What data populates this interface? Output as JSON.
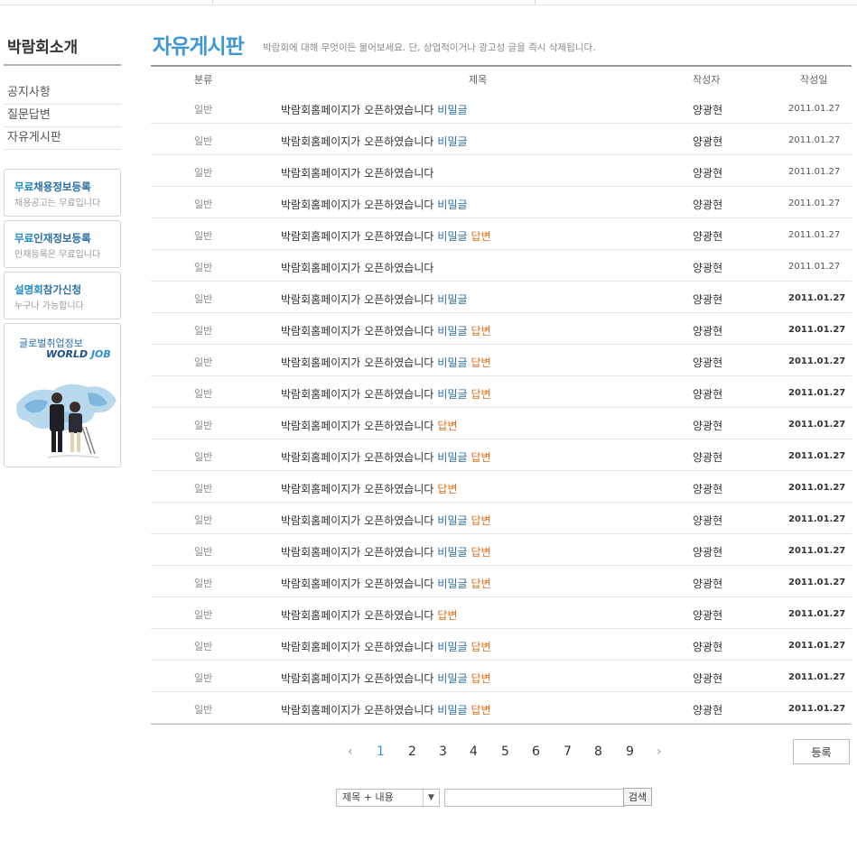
{
  "sidebar": {
    "title": "박람회소개",
    "menu": [
      "공지사항",
      "질문답변",
      "자유게시판"
    ],
    "banners": [
      {
        "title_prefix": "무료",
        "title_main": "채용정보등록",
        "sub": "채용공고는 무료입니다"
      },
      {
        "title_prefix": "무료",
        "title_main": "인재정보등록",
        "sub": "인재등록은 무료입니다"
      },
      {
        "title_prefix": "설명회",
        "title_main": "참가신청",
        "sub": "누구나 가능합니다"
      }
    ],
    "worldjob": {
      "korean": "글로벌취업정보",
      "logo_a": "WORLD ",
      "logo_b": "JOB"
    }
  },
  "board": {
    "title": "자유게시판",
    "description": "박람회에 대해 무엇이든 물어보세요. 단, 상업적이거나 광고성 글을 즉시 삭제됩니다.",
    "headers": {
      "category": "분류",
      "subject": "제목",
      "author": "작성자",
      "date": "작성일"
    },
    "secret_tag": "비밀글",
    "reply_tag": "답변",
    "rows": [
      {
        "category": "일반",
        "subject": "박람회홈페이지가 오픈하였습니다",
        "secret": true,
        "reply": false,
        "author": "양광현",
        "date": "2011.01.27",
        "bold": false
      },
      {
        "category": "일반",
        "subject": "박람회홈페이지가 오픈하였습니다",
        "secret": true,
        "reply": false,
        "author": "양광현",
        "date": "2011.01.27",
        "bold": false
      },
      {
        "category": "일반",
        "subject": "박람회홈페이지가 오픈하였습니다",
        "secret": false,
        "reply": false,
        "author": "양광현",
        "date": "2011.01.27",
        "bold": false
      },
      {
        "category": "일반",
        "subject": "박람회홈페이지가 오픈하였습니다",
        "secret": true,
        "reply": false,
        "author": "양광현",
        "date": "2011.01.27",
        "bold": false
      },
      {
        "category": "일반",
        "subject": "박람회홈페이지가 오픈하였습니다",
        "secret": true,
        "reply": true,
        "author": "양광현",
        "date": "2011.01.27",
        "bold": false
      },
      {
        "category": "일반",
        "subject": "박람회홈페이지가 오픈하였습니다",
        "secret": false,
        "reply": false,
        "author": "양광현",
        "date": "2011.01.27",
        "bold": false
      },
      {
        "category": "일반",
        "subject": "박람회홈페이지가 오픈하였습니다",
        "secret": true,
        "reply": false,
        "author": "양광현",
        "date": "2011.01.27",
        "bold": true
      },
      {
        "category": "일반",
        "subject": "박람회홈페이지가 오픈하였습니다",
        "secret": true,
        "reply": true,
        "author": "양광현",
        "date": "2011.01.27",
        "bold": true
      },
      {
        "category": "일반",
        "subject": "박람회홈페이지가 오픈하였습니다",
        "secret": true,
        "reply": true,
        "author": "양광현",
        "date": "2011.01.27",
        "bold": true
      },
      {
        "category": "일반",
        "subject": "박람회홈페이지가 오픈하였습니다",
        "secret": true,
        "reply": true,
        "author": "양광현",
        "date": "2011.01.27",
        "bold": true
      },
      {
        "category": "일반",
        "subject": "박람회홈페이지가 오픈하였습니다",
        "secret": false,
        "reply": true,
        "author": "양광현",
        "date": "2011.01.27",
        "bold": true
      },
      {
        "category": "일반",
        "subject": "박람회홈페이지가 오픈하였습니다",
        "secret": true,
        "reply": true,
        "author": "양광현",
        "date": "2011.01.27",
        "bold": true
      },
      {
        "category": "일반",
        "subject": "박람회홈페이지가 오픈하였습니다",
        "secret": false,
        "reply": true,
        "author": "양광현",
        "date": "2011.01.27",
        "bold": true
      },
      {
        "category": "일반",
        "subject": "박람회홈페이지가 오픈하였습니다",
        "secret": true,
        "reply": true,
        "author": "양광현",
        "date": "2011.01.27",
        "bold": true
      },
      {
        "category": "일반",
        "subject": "박람회홈페이지가 오픈하였습니다",
        "secret": true,
        "reply": true,
        "author": "양광현",
        "date": "2011.01.27",
        "bold": true
      },
      {
        "category": "일반",
        "subject": "박람회홈페이지가 오픈하였습니다",
        "secret": true,
        "reply": true,
        "author": "양광현",
        "date": "2011.01.27",
        "bold": true
      },
      {
        "category": "일반",
        "subject": "박람회홈페이지가 오픈하였습니다",
        "secret": false,
        "reply": true,
        "author": "양광현",
        "date": "2011.01.27",
        "bold": true
      },
      {
        "category": "일반",
        "subject": "박람회홈페이지가 오픈하였습니다",
        "secret": true,
        "reply": true,
        "author": "양광현",
        "date": "2011.01.27",
        "bold": true
      },
      {
        "category": "일반",
        "subject": "박람회홈페이지가 오픈하였습니다",
        "secret": true,
        "reply": true,
        "author": "양광현",
        "date": "2011.01.27",
        "bold": true
      },
      {
        "category": "일반",
        "subject": "박람회홈페이지가 오픈하였습니다",
        "secret": true,
        "reply": true,
        "author": "양광현",
        "date": "2011.01.27",
        "bold": true
      }
    ]
  },
  "pagination": {
    "prev": "‹",
    "next": "›",
    "pages": [
      "1",
      "2",
      "3",
      "4",
      "5",
      "6",
      "7",
      "8",
      "9"
    ],
    "current": "1"
  },
  "register_button": "등록",
  "search": {
    "scope": "제목 + 내용",
    "query": "",
    "button": "검색"
  },
  "colors": {
    "accent": "#3d97d3",
    "secret": "#2a6ea3",
    "reply": "#e06d18"
  }
}
